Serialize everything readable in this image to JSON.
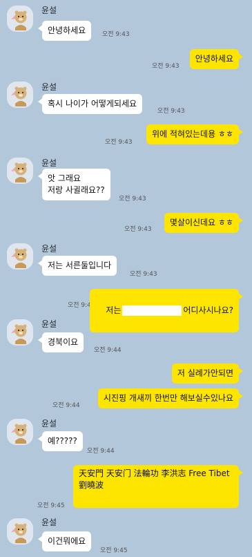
{
  "sender_name": "윤설",
  "avatar_icon": "bear-avatar-icon",
  "colors": {
    "background": "#b2c7da",
    "outgoing_bubble": "#fee500",
    "incoming_bubble": "#ffffff"
  },
  "messages": [
    {
      "dir": "in",
      "text": "안녕하세요",
      "time": "오전 9:43"
    },
    {
      "dir": "out",
      "text": "안녕하세요",
      "time": "오전 9:43"
    },
    {
      "dir": "in",
      "text": "혹시 나이가 어떻게되세요",
      "time": "오전 9:43"
    },
    {
      "dir": "out",
      "text": "위에 적혀있는데용 ㅎㅎ",
      "time": "오전 9:43"
    },
    {
      "dir": "in",
      "text": "앗 그래요\n저랑 사귈래요??",
      "time": "오전 9:43"
    },
    {
      "dir": "out",
      "text": "몇살이신데요 ㅎㅎ",
      "time": "오전 9:43"
    },
    {
      "dir": "in",
      "text": "저는 서른둘입니다",
      "time": "오전 9:43"
    },
    {
      "dir": "out",
      "text_before": "저는",
      "text_after": "어디사시나요?",
      "time": "오전 9:44"
    },
    {
      "dir": "in",
      "text": "경북이요",
      "time": "오전 9:44"
    },
    {
      "dir": "out",
      "text": "저 실례가안되면",
      "time": ""
    },
    {
      "dir": "out",
      "text": "시진핑 개새끼 한번만 해보실수있나요",
      "time": "오전 9:44"
    },
    {
      "dir": "in",
      "text": "예?????",
      "time": "오전 9:44"
    },
    {
      "dir": "out",
      "text": "天安門 天安门 法輪功 李洪志 Free Tibet\n劉曉波",
      "time": "오전 9:45"
    },
    {
      "dir": "in",
      "text": "이건뭐에요",
      "time": "오전 9:45"
    }
  ]
}
